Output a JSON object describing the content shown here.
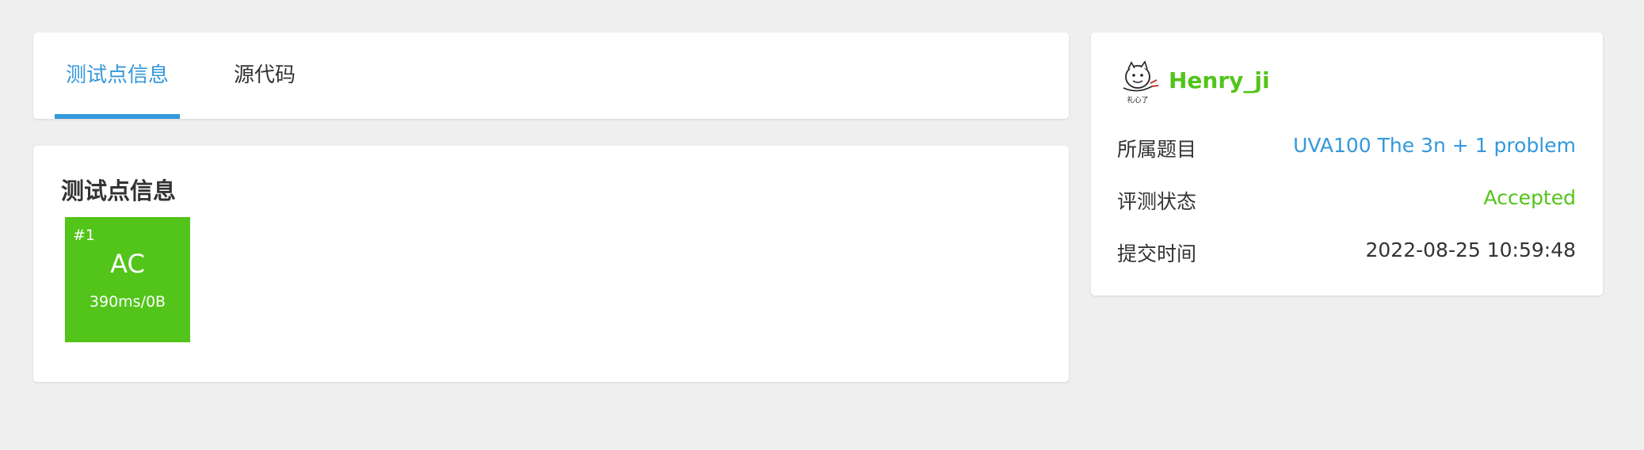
{
  "tabs": [
    {
      "label": "测试点信息",
      "active": true
    },
    {
      "label": "源代码",
      "active": false
    }
  ],
  "testcase_section": {
    "heading": "测试点信息",
    "cases": [
      {
        "id": "#1",
        "status": "AC",
        "stats": "390ms/0B",
        "color": "#52c41a"
      }
    ]
  },
  "sidebar": {
    "avatar_icon": "avatar-cartoon-icon",
    "avatar_caption": "礼心了",
    "username": "Henry_ji",
    "rows": [
      {
        "label": "所属题目",
        "value": "UVA100 The 3n + 1 problem"
      },
      {
        "label": "评测状态",
        "value": "Accepted"
      },
      {
        "label": "提交时间",
        "value": "2022-08-25 10:59:48"
      }
    ]
  },
  "colors": {
    "accent": "#3498db",
    "success": "#52c41a",
    "background": "#efefef"
  }
}
